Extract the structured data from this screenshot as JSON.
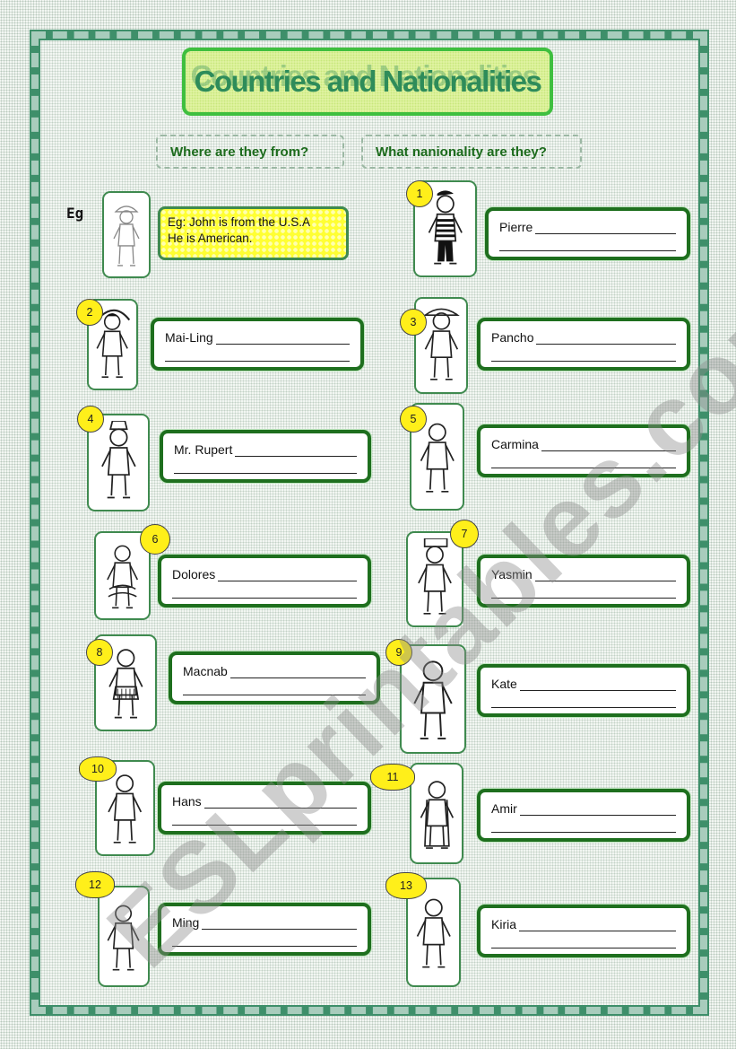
{
  "title": "Countries and Nationalities",
  "headings": {
    "left": "Where are they from?",
    "right": "What nanionality are they?"
  },
  "example": {
    "label": "Eg",
    "line1": "Eg: John is from the U.S.A",
    "line2": "He is American."
  },
  "items": [
    {
      "number": "1",
      "name": "Pierre",
      "figure": "french-mime-icon"
    },
    {
      "number": "2",
      "name": "Mai-Ling",
      "figure": "japanese-girl-umbrella-icon"
    },
    {
      "number": "3",
      "name": "Pancho",
      "figure": "mexican-boy-sombrero-icon"
    },
    {
      "number": "4",
      "name": "Mr. Rupert",
      "figure": "leprechaun-icon"
    },
    {
      "number": "5",
      "name": "Carmina",
      "figure": "skater-girl-icon"
    },
    {
      "number": "6",
      "name": "Dolores",
      "figure": "flamenco-dancer-icon"
    },
    {
      "number": "7",
      "name": "Yasmin",
      "figure": "woman-carrying-drum-icon"
    },
    {
      "number": "8",
      "name": "Macnab",
      "figure": "scottish-boy-kilt-icon"
    },
    {
      "number": "9",
      "name": "Kate",
      "figure": "safari-girl-icon"
    },
    {
      "number": "10",
      "name": "Hans",
      "figure": "bavarian-dancer-icon"
    },
    {
      "number": "11",
      "name": "Amir",
      "figure": "arab-man-robe-icon"
    },
    {
      "number": "12",
      "name": "Ming",
      "figure": "chinese-man-icon"
    },
    {
      "number": "13",
      "name": "Kiria",
      "figure": "indian-dancer-icon"
    }
  ],
  "watermark": "ESLprintables.com",
  "colors": {
    "frame": "#3e8f6a",
    "title_border": "#3fbf3f",
    "title_text": "#2e8c5a",
    "answer_border": "#1e6f1e",
    "badge": "#ffef1a",
    "example_bg": "#ffff33"
  }
}
